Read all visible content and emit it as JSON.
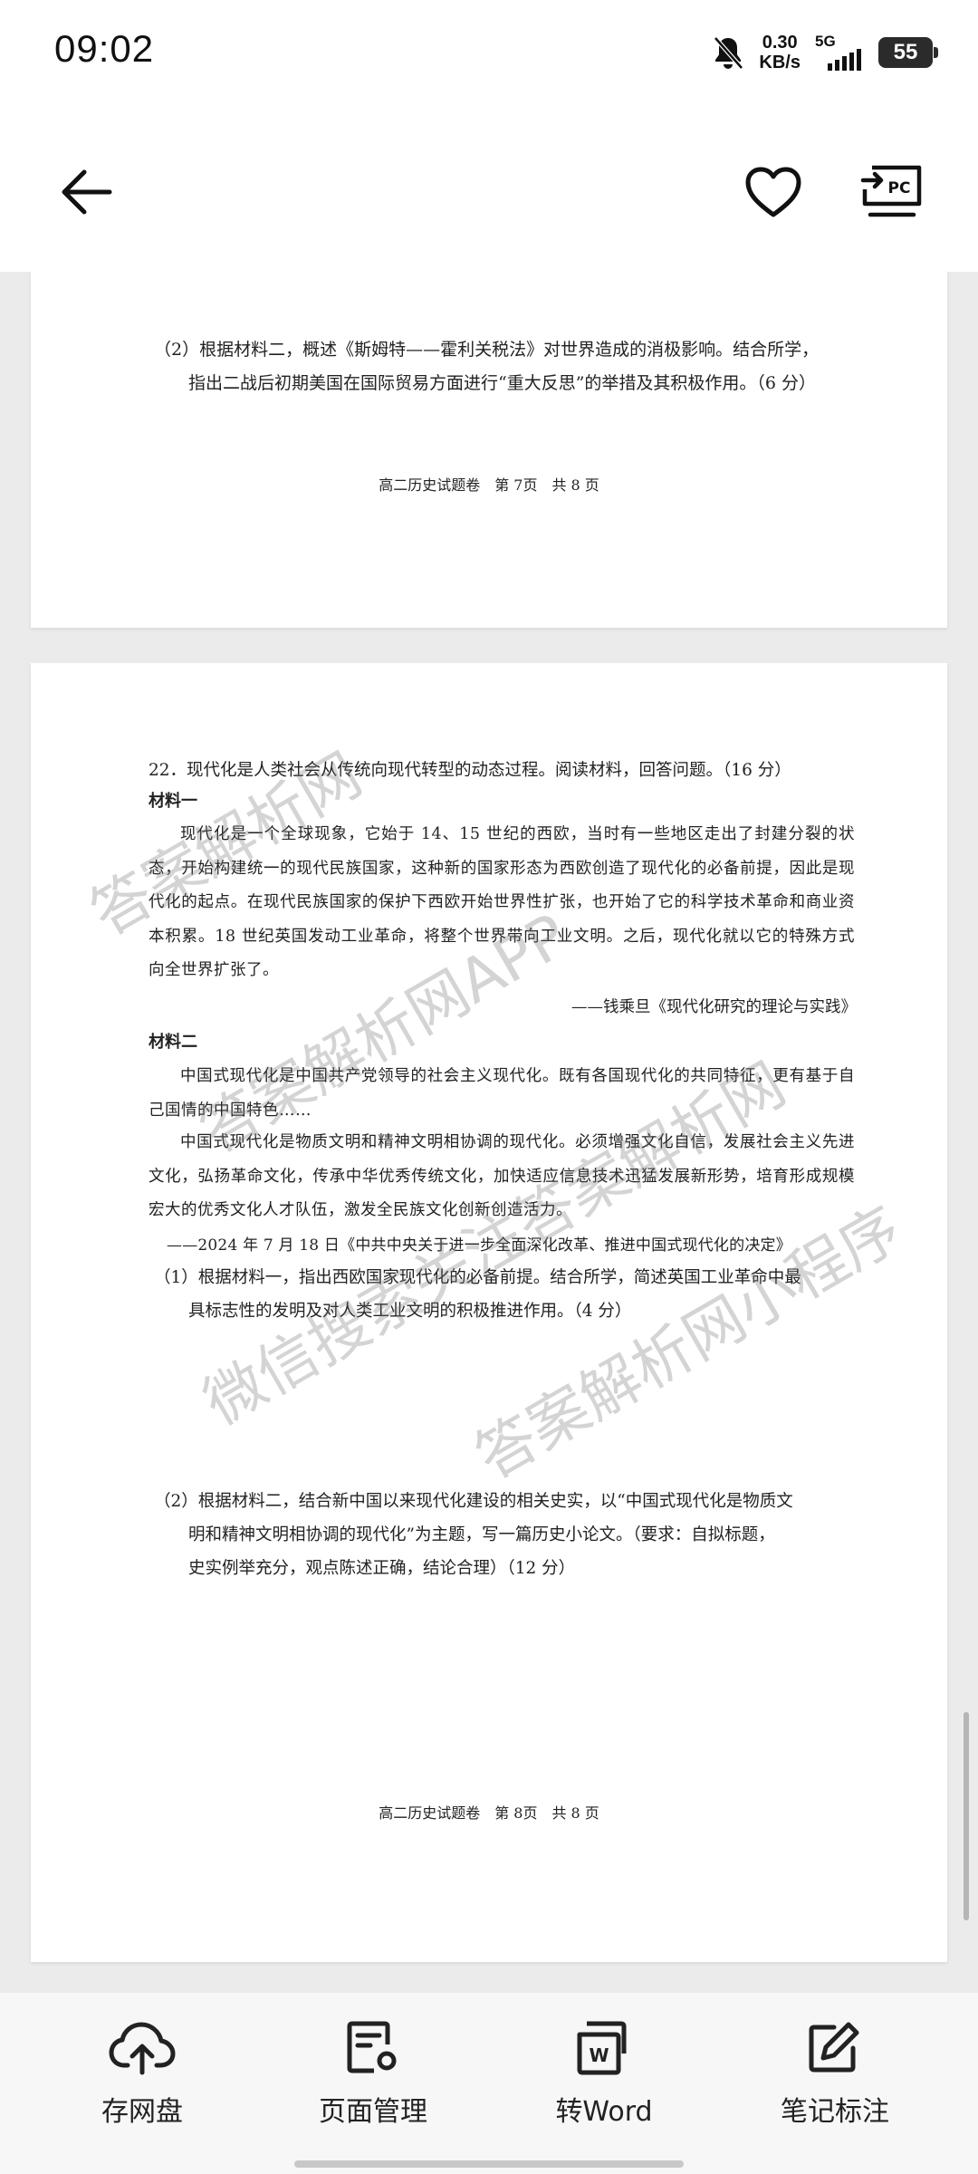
{
  "status_bar": {
    "time": "09:02",
    "speed_value": "0.30",
    "speed_unit": "KB/s",
    "network": "5G",
    "battery": "55"
  },
  "toolbar": {
    "back_icon": "arrow-left-icon",
    "favorite_icon": "heart-icon",
    "pc_icon": "pc-screen-icon",
    "pc_label": "PC"
  },
  "page7": {
    "question_2_line1": "（2）根据材料二，概述《斯姆特——霍利关税法》对世界造成的消极影响。结合所学，",
    "question_2_line2": "指出二战后初期美国在国际贸易方面进行“重大反思”的举措及其积极作用。（6 分）",
    "footer": "高二历史试题卷　第 7页　共 8 页"
  },
  "page8": {
    "q22": "22．现代化是人类社会从传统向现代转型的动态过程。阅读材料，回答问题。（16 分）",
    "material1_label": "材料一",
    "material1_text": "现代化是一个全球现象，它始于 14、15 世纪的西欧，当时有一些地区走出了封建分裂的状态，开始构建统一的现代民族国家，这种新的国家形态为西欧创造了现代化的必备前提，因此是现代化的起点。在现代民族国家的保护下西欧开始世界性扩张，也开始了它的科学技术革命和商业资本积累。18 世纪英国发动工业革命，将整个世界带向工业文明。之后，现代化就以它的特殊方式向全世界扩张了。",
    "material1_source": "——钱乘旦《现代化研究的理论与实践》",
    "material2_label": "材料二",
    "material2_p1": "中国式现代化是中国共产党领导的社会主义现代化。既有各国现代化的共同特征，更有基于自己国情的中国特色……",
    "material2_p2": "中国式现代化是物质文明和精神文明相协调的现代化。必须增强文化自信，发展社会主义先进文化，弘扬革命文化，传承中华优秀传统文化，加快适应信息技术迅猛发展新形势，培育形成规模宏大的优秀文化人才队伍，激发全民族文化创新创造活力。",
    "material2_source": "——2024 年 7 月 18 日《中共中央关于进一步全面深化改革、推进中国式现代化的决定》",
    "q1_line1": "（1）根据材料一，指出西欧国家现代化的必备前提。结合所学，简述英国工业革命中最",
    "q1_line2": "具标志性的发明及对人类工业文明的积极推进作用。（4 分）",
    "q2_line1": "（2）根据材料二，结合新中国以来现代化建设的相关史实，以“中国式现代化是物质文",
    "q2_line2": "明和精神文明相协调的现代化”为主题，写一篇历史小论文。（要求：自拟标题，",
    "q2_line3": "史实例举充分，观点陈述正确，结论合理）（12 分）",
    "footer": "高二历史试题卷　第 8页　共 8 页"
  },
  "watermarks": [
    "答案解析网",
    "答案解析网APP",
    "微信搜索关注答案解析网",
    "答案解析网小程序"
  ],
  "bottom_bar": {
    "items": [
      {
        "label": "存网盘",
        "icon": "cloud-upload-icon"
      },
      {
        "label": "页面管理",
        "icon": "page-settings-icon"
      },
      {
        "label": "转Word",
        "icon": "word-convert-icon"
      },
      {
        "label": "笔记标注",
        "icon": "edit-note-icon"
      }
    ],
    "word_badge": "W"
  }
}
